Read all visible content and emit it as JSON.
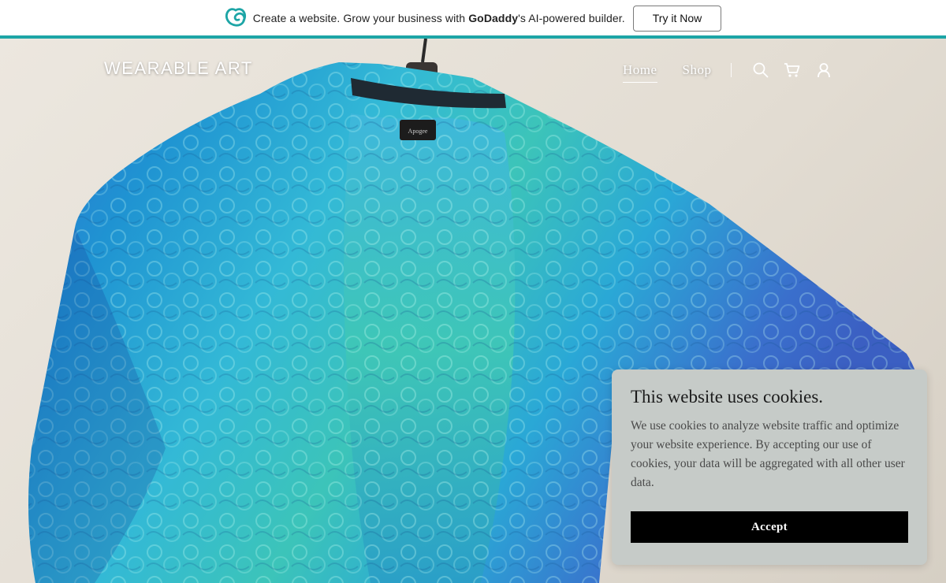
{
  "promo": {
    "text_before": "Create a website. Grow your business with ",
    "brand": "GoDaddy",
    "text_after": "'s AI-powered builder.",
    "button_label": "Try it Now",
    "accent_color": "#1da5a6"
  },
  "site": {
    "title": "WEARABLE ART"
  },
  "nav": {
    "items": [
      {
        "label": "Home",
        "active": true
      },
      {
        "label": "Shop",
        "active": false
      }
    ],
    "icons": [
      "search-icon",
      "cart-icon",
      "account-icon"
    ]
  },
  "hero": {
    "garment_label": "Apogee"
  },
  "cookie": {
    "title": "This website uses cookies.",
    "body": "We use cookies to analyze website traffic and optimize your website experience. By accepting our use of cookies, your data will be aggregated with all other user data.",
    "accept_label": "Accept"
  }
}
